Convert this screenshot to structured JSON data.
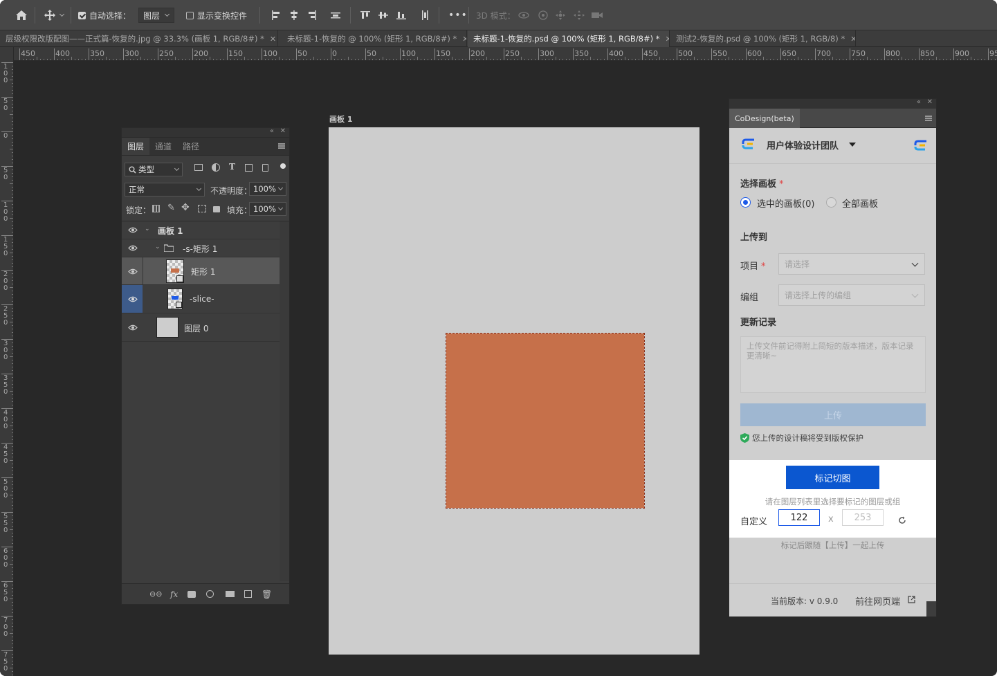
{
  "options_bar": {
    "auto_select_label": "自动选择：",
    "auto_select_checked": true,
    "auto_select_target": "图层",
    "show_transform_label": "显示变换控件",
    "show_transform_checked": false,
    "more_label": "•••",
    "mode_3d_label": "3D 模式："
  },
  "tabs": [
    {
      "label": "层级权限改版配图——正式篇-恢复的.jpg @ 33.3% (画板 1, RGB/8#) *",
      "active": false
    },
    {
      "label": "未标题-1-恢复的 @ 100% (矩形 1, RGB/8#) *",
      "active": false
    },
    {
      "label": "未标题-1-恢复的.psd @ 100% (矩形 1, RGB/8#) *",
      "active": true
    },
    {
      "label": "测试2-恢复的.psd @ 100% (矩形 1, RGB/8) *",
      "active": false
    }
  ],
  "ruler": {
    "h_labels": [
      "450",
      "400",
      "350",
      "300",
      "250",
      "200",
      "150",
      "100",
      "50",
      "0",
      "50",
      "100",
      "150",
      "200",
      "250",
      "300",
      "350",
      "400",
      "450",
      "500",
      "550",
      "600",
      "650",
      "700",
      "750",
      "800",
      "850",
      "900",
      "95"
    ],
    "v_labels": [
      "100",
      "50",
      "0",
      "50",
      "100",
      "150",
      "200",
      "250",
      "300",
      "350",
      "400",
      "450",
      "500",
      "550",
      "600",
      "650",
      "700",
      "750"
    ]
  },
  "artboard": {
    "label": "画板 1",
    "background": "#cdcdcd",
    "rect_color": "#c6704a"
  },
  "layers_panel": {
    "tabs": [
      "图层",
      "通道",
      "路径"
    ],
    "active_tab": "图层",
    "filter_kind": "类型",
    "blend_mode": "正常",
    "opacity_label": "不透明度：",
    "opacity_value": "100%",
    "lock_label": "锁定：",
    "fill_label": "填充：",
    "fill_value": "100%",
    "layers": [
      {
        "name": "画板 1",
        "type": "artboard"
      },
      {
        "name": "-s-矩形 1",
        "type": "group"
      },
      {
        "name": "矩形 1",
        "type": "layer",
        "selected": true
      },
      {
        "name": "-slice-",
        "type": "layer"
      },
      {
        "name": "图层 0",
        "type": "layer"
      }
    ]
  },
  "codesign": {
    "tab_label": "CoDesign(beta)",
    "team_name": "用户体验设计团队",
    "select_artboard_label": "选择画板",
    "radio_selected_label": "选中的画板(0)",
    "radio_all_label": "全部画板",
    "upload_to_label": "上传到",
    "project_label": "项目",
    "project_placeholder": "请选择",
    "group_label": "编组",
    "group_placeholder": "请选择上传的编组",
    "changelog_label": "更新记录",
    "changelog_placeholder": "上传文件前记得附上简短的版本描述，版本记录更清晰~",
    "upload_button": "上传",
    "copyright_note": "您上传的设计稿将受到版权保护",
    "mark_slice_button": "标记切图",
    "mark_hint": "请在图层列表里选择要标记的图层或组",
    "custom_label": "自定义",
    "width_value": "122",
    "times_symbol": "x",
    "height_value": "253",
    "after_mark_note": "标记后跟随【上传】一起上传",
    "version_label": "当前版本: v 0.9.0",
    "goto_web_label": "前往网页端",
    "accent": "#0b57d0"
  }
}
